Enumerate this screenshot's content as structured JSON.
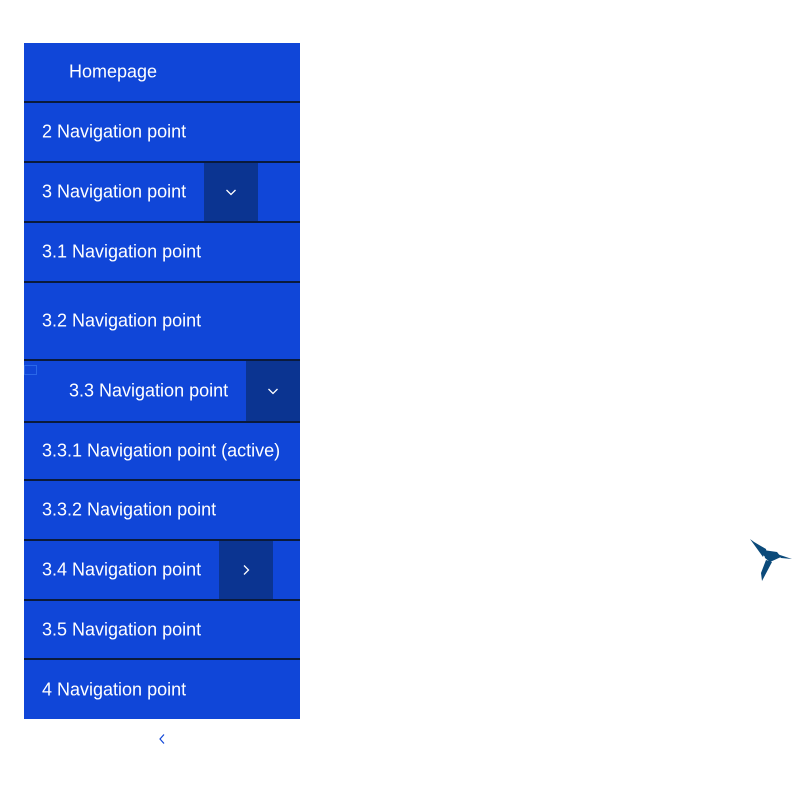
{
  "nav": {
    "items": [
      {
        "label": "Homepage"
      },
      {
        "label": "2 Navigation point"
      },
      {
        "label": "3 Navigation point"
      },
      {
        "label": "3.1 Navigation point"
      },
      {
        "label": "3.2 Navigation point"
      },
      {
        "label": "3.3 Navigation point"
      },
      {
        "label": "3.3.1 Navigation point (active)"
      },
      {
        "label": "3.3.2 Navigation point"
      },
      {
        "label": "3.4 Navigation point"
      },
      {
        "label": "3.5 Navigation point"
      },
      {
        "label": "4 Navigation point"
      }
    ]
  },
  "icons": {
    "expand": "chevron-down-icon",
    "submenu": "chevron-right-icon",
    "collapse": "chevron-left-icon",
    "logo": "hummingbird-logo"
  },
  "colors": {
    "nav_bg": "#1046d8",
    "toggle_bg": "#0b3491",
    "divider": "#0a1a3c",
    "logo": "#0b4a7a",
    "page_bg": "#ffffff"
  }
}
